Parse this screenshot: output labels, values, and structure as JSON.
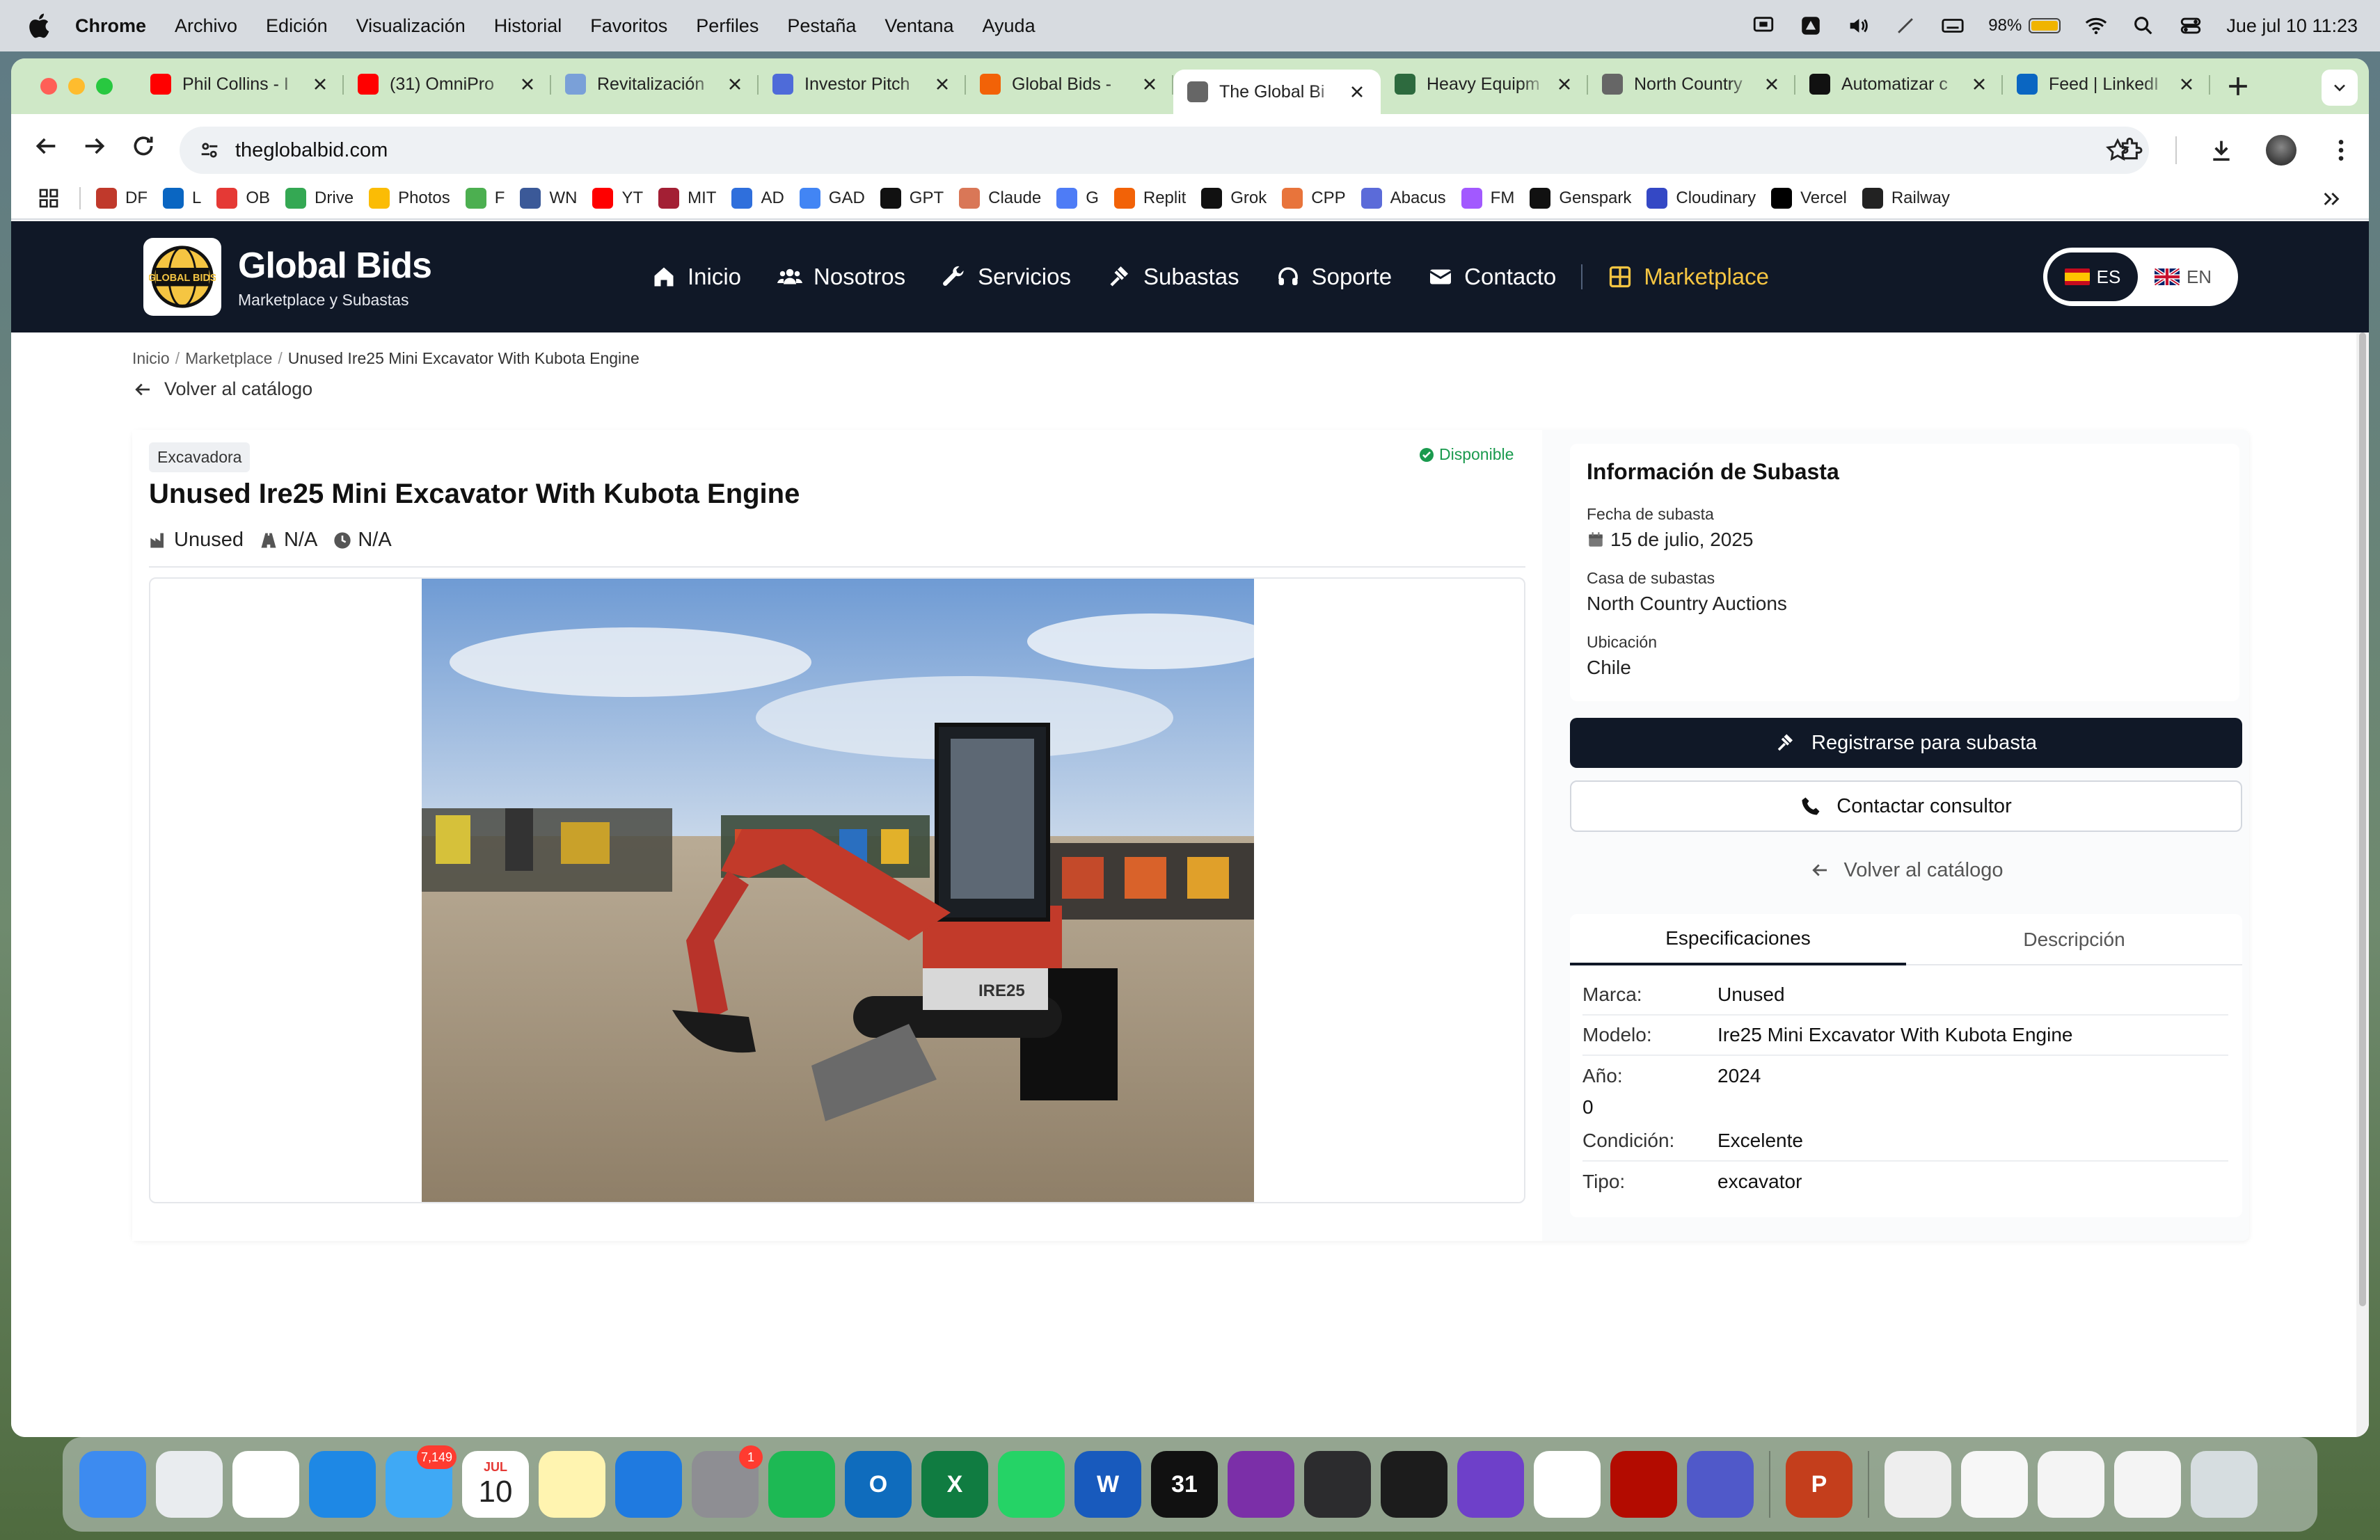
{
  "menubar": {
    "app": "Chrome",
    "items": [
      "Archivo",
      "Edición",
      "Visualización",
      "Historial",
      "Favoritos",
      "Perfiles",
      "Pestaña",
      "Ventana",
      "Ayuda"
    ],
    "battery": "98%",
    "battery_level": 0.98,
    "datetime": "Jue jul 10  11:23"
  },
  "tabs": [
    {
      "title": "Phil Collins - I",
      "icon": "youtube-icon",
      "color": "#ff0000"
    },
    {
      "title": "(31) OmniPro",
      "icon": "youtube-icon",
      "color": "#ff0000"
    },
    {
      "title": "Revitalización",
      "icon": "wave-icon",
      "color": "#7aa0d8"
    },
    {
      "title": "Investor Pitch",
      "icon": "pitch-icon",
      "color": "#4e6bd9"
    },
    {
      "title": "Global Bids -",
      "icon": "replit-icon",
      "color": "#f26207"
    },
    {
      "title": "The Global Bi",
      "icon": "globe-icon",
      "color": "#666666"
    },
    {
      "title": "Heavy Equipm",
      "icon": "equipment-icon",
      "color": "#2d6a3e"
    },
    {
      "title": "North Country",
      "icon": "globe-icon",
      "color": "#666666"
    },
    {
      "title": "Automatizar c",
      "icon": "openai-icon",
      "color": "#111111"
    },
    {
      "title": "Feed | LinkedI",
      "icon": "linkedin-icon",
      "color": "#0a66c2"
    }
  ],
  "active_tab": 5,
  "url": "theglobalbid.com",
  "bookmarks": [
    {
      "label": "DF",
      "color": "#c0392b"
    },
    {
      "label": "L",
      "color": "#0a66c2"
    },
    {
      "label": "OB",
      "color": "#e53935"
    },
    {
      "label": "Drive",
      "color": "#34a853"
    },
    {
      "label": "Photos",
      "color": "#fbbc05"
    },
    {
      "label": "F",
      "color": "#4caf50"
    },
    {
      "label": "WN",
      "color": "#3b5998"
    },
    {
      "label": "YT",
      "color": "#ff0000"
    },
    {
      "label": "MIT",
      "color": "#a31f34"
    },
    {
      "label": "AD",
      "color": "#2f6fdc"
    },
    {
      "label": "GAD",
      "color": "#4285f4"
    },
    {
      "label": "GPT",
      "color": "#111111"
    },
    {
      "label": "Claude",
      "color": "#d97757"
    },
    {
      "label": "G",
      "color": "#4e7cf6"
    },
    {
      "label": "Replit",
      "color": "#f26207"
    },
    {
      "label": "Grok",
      "color": "#111111"
    },
    {
      "label": "CPP",
      "color": "#e8743b"
    },
    {
      "label": "Abacus",
      "color": "#5b6bd9"
    },
    {
      "label": "FM",
      "color": "#a259ff"
    },
    {
      "label": "Genspark",
      "color": "#111111"
    },
    {
      "label": "Cloudinary",
      "color": "#3448c5"
    },
    {
      "label": "Vercel",
      "color": "#000000"
    },
    {
      "label": "Railway",
      "color": "#222222"
    }
  ],
  "site": {
    "brand": "Global Bids",
    "tagline": "Marketplace y Subastas",
    "logo_text": "GLOBAL BIDS",
    "nav": [
      {
        "label": "Inicio",
        "icon": "home-icon"
      },
      {
        "label": "Nosotros",
        "icon": "users-icon"
      },
      {
        "label": "Servicios",
        "icon": "wrench-icon"
      },
      {
        "label": "Subastas",
        "icon": "gavel-icon"
      },
      {
        "label": "Soporte",
        "icon": "headset-icon"
      },
      {
        "label": "Contacto",
        "icon": "envelope-icon"
      },
      {
        "label": "Marketplace",
        "icon": "grid-icon"
      }
    ],
    "lang": {
      "es": "ES",
      "en": "EN"
    },
    "accent": "#f5c542",
    "navy": "#101827"
  },
  "breadcrumb": {
    "home": "Inicio",
    "section": "Marketplace",
    "current": "Unused Ire25 Mini Excavator With Kubota Engine"
  },
  "back_label": "Volver al catálogo",
  "product": {
    "category": "Excavadora",
    "status": "Disponible",
    "title": "Unused Ire25 Mini Excavator With Kubota Engine",
    "condition": "Unused",
    "mileage": "N/A",
    "hours": "N/A",
    "machine_label": "IRE25"
  },
  "auction": {
    "heading": "Información de Subasta",
    "date_label": "Fecha de subasta",
    "date": "15 de julio, 2025",
    "house_label": "Casa de subastas",
    "house": "North Country Auctions",
    "location_label": "Ubicación",
    "location": "Chile"
  },
  "actions": {
    "register": "Registrarse para subasta",
    "contact": "Contactar consultor",
    "back": "Volver al catálogo"
  },
  "spec_tabs": [
    "Especificaciones",
    "Descripción"
  ],
  "specs": [
    {
      "k": "Marca:",
      "v": "Unused"
    },
    {
      "k": "Modelo:",
      "v": "Ire25 Mini Excavator With Kubota Engine"
    },
    {
      "k": "Año:",
      "v": "2024"
    },
    {
      "k": "",
      "v": "0"
    },
    {
      "k": "Condición:",
      "v": "Excelente"
    },
    {
      "k": "Tipo:",
      "v": "excavator"
    }
  ],
  "dock": [
    {
      "app": "finder",
      "color": "#3d8bf0"
    },
    {
      "app": "launchpad",
      "color": "#e9ecef"
    },
    {
      "app": "chrome",
      "color": "#ffffff"
    },
    {
      "app": "safari",
      "color": "#1e88e5"
    },
    {
      "app": "mail",
      "color": "#3fa9f5",
      "badge": "7,149"
    },
    {
      "app": "calendar",
      "color": "#ffffff",
      "month": "JUL",
      "day": "10"
    },
    {
      "app": "notes",
      "color": "#fff4b0"
    },
    {
      "app": "keynote",
      "color": "#1f7ae0"
    },
    {
      "app": "settings",
      "color": "#8e8e93",
      "badge": "1"
    },
    {
      "app": "spotify",
      "color": "#1db954"
    },
    {
      "app": "outlook",
      "color": "#0f6cbd",
      "letter": "O"
    },
    {
      "app": "excel",
      "color": "#107c41",
      "letter": "X"
    },
    {
      "app": "whatsapp",
      "color": "#25d366"
    },
    {
      "app": "word",
      "color": "#185abd",
      "letter": "W"
    },
    {
      "app": "fantastical",
      "color": "#111111",
      "letter": "31"
    },
    {
      "app": "screen-recorder",
      "color": "#7b2fa8"
    },
    {
      "app": "iphone-mirroring",
      "color": "#2c2c2e"
    },
    {
      "app": "replit",
      "color": "#1c1c1c"
    },
    {
      "app": "github",
      "color": "#6e40c9"
    },
    {
      "app": "vscode",
      "color": "#ffffff"
    },
    {
      "app": "acrobat",
      "color": "#b30b00"
    },
    {
      "app": "teams",
      "color": "#5059c9"
    },
    {
      "app": "powerpoint",
      "color": "#c43e1c",
      "letter": "P"
    },
    {
      "app": "doc-stack",
      "color": "#eeeeee"
    },
    {
      "app": "pdf-file",
      "color": "#f7f7f7"
    },
    {
      "app": "mail-window-1",
      "color": "#f4f4f4"
    },
    {
      "app": "mail-window-2",
      "color": "#f4f4f4"
    },
    {
      "app": "trash",
      "color": "#d6dde0"
    }
  ]
}
